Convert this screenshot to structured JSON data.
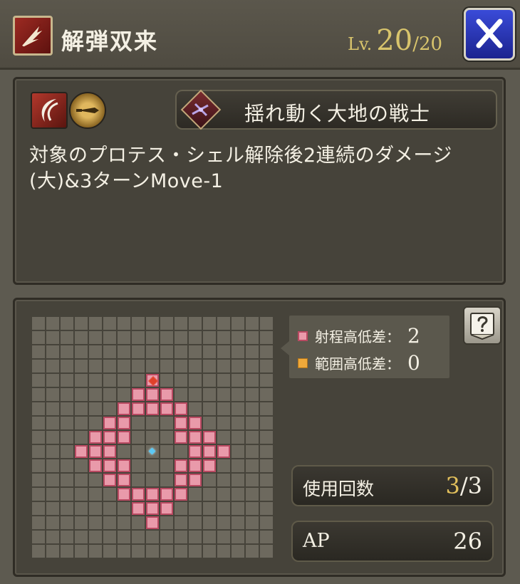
{
  "header": {
    "title": "解弾双来",
    "level_label": "Lv.",
    "level_current": "20",
    "level_max": "/20",
    "skill_icon": "claw-slash-icon",
    "close_icon": "close-icon"
  },
  "info": {
    "element_icons": [
      "slash-attack-icon",
      "thrust-attack-icon"
    ],
    "job_icon": "crossbow-job-icon",
    "job_name": "揺れ動く大地の戦士",
    "description": "対象のプロテス・シェル解除後2連続のダメージ(大)&3ターンMove-1"
  },
  "range": {
    "legend": {
      "range_height_label": "射程高低差：",
      "range_height_value": "2",
      "area_height_label": "範囲高低差：",
      "area_height_value": "0"
    },
    "help_icon": "help-book-icon",
    "grid_size": 17,
    "range_cells": [
      [
        4,
        8
      ],
      [
        5,
        7
      ],
      [
        5,
        8
      ],
      [
        5,
        9
      ],
      [
        6,
        6
      ],
      [
        6,
        7
      ],
      [
        6,
        8
      ],
      [
        6,
        9
      ],
      [
        6,
        10
      ],
      [
        7,
        5
      ],
      [
        7,
        6
      ],
      [
        7,
        10
      ],
      [
        7,
        11
      ],
      [
        8,
        4
      ],
      [
        8,
        5
      ],
      [
        8,
        6
      ],
      [
        8,
        10
      ],
      [
        8,
        11
      ],
      [
        8,
        12
      ],
      [
        9,
        3
      ],
      [
        9,
        4
      ],
      [
        9,
        5
      ],
      [
        9,
        11
      ],
      [
        9,
        12
      ],
      [
        9,
        13
      ],
      [
        10,
        4
      ],
      [
        10,
        5
      ],
      [
        10,
        6
      ],
      [
        10,
        10
      ],
      [
        10,
        11
      ],
      [
        10,
        12
      ],
      [
        11,
        5
      ],
      [
        11,
        6
      ],
      [
        11,
        10
      ],
      [
        11,
        11
      ],
      [
        12,
        6
      ],
      [
        12,
        7
      ],
      [
        12,
        8
      ],
      [
        12,
        9
      ],
      [
        12,
        10
      ],
      [
        13,
        7
      ],
      [
        13,
        8
      ],
      [
        13,
        9
      ],
      [
        14,
        8
      ]
    ],
    "target_cell": [
      4,
      8
    ],
    "center_cell": [
      9,
      8
    ]
  },
  "stats": {
    "uses_label": "使用回数",
    "uses_current": "3",
    "uses_max": "/3",
    "ap_label": "AP",
    "ap_value": "26"
  },
  "colors": {
    "range_fill": "#e99aaa",
    "range_border": "#b94a62",
    "area_color": "#f0a93a",
    "level_gold": "#d8c46c",
    "close_blue": "#2a35b8"
  }
}
